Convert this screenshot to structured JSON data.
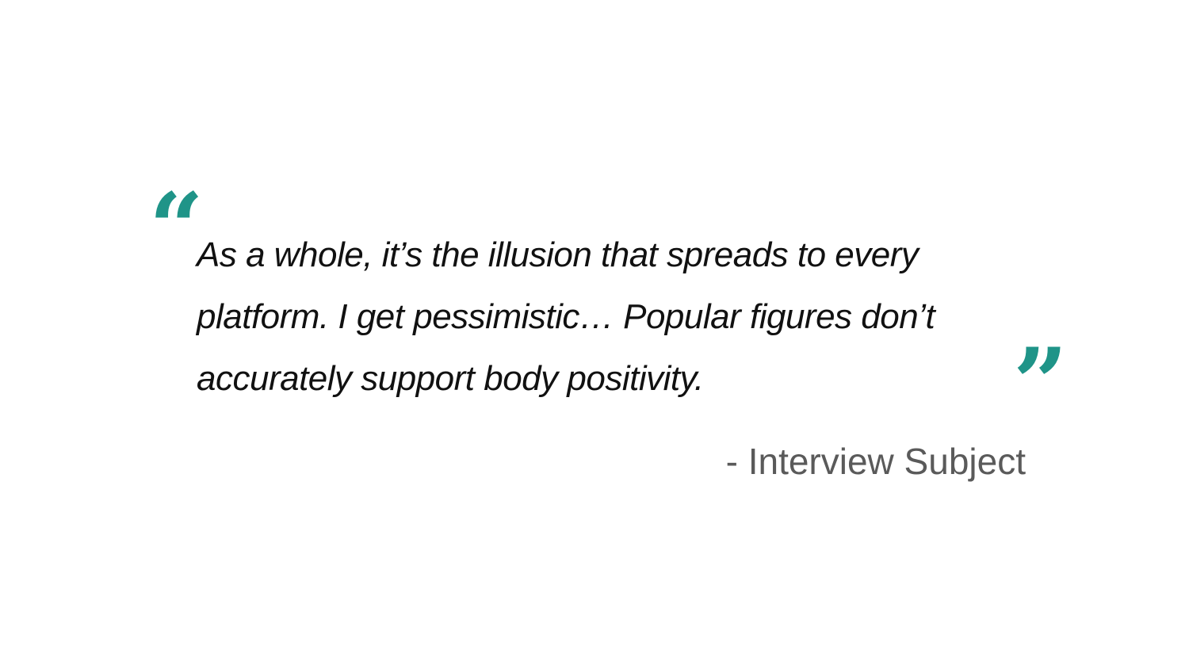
{
  "quote": {
    "lines": [
      "As a whole, it’s the illusion that spreads to every",
      "platform. I get pessimistic… Popular figures don’t",
      "accurately support body positivity."
    ],
    "open_mark": "“",
    "close_mark": "”",
    "attribution": "- Interview Subject"
  },
  "colors": {
    "accent": "#1f9488",
    "text": "#111111",
    "attribution": "#5a5a5a",
    "background": "#ffffff"
  },
  "icons": {
    "open": "open-quote-icon",
    "close": "close-quote-icon"
  }
}
